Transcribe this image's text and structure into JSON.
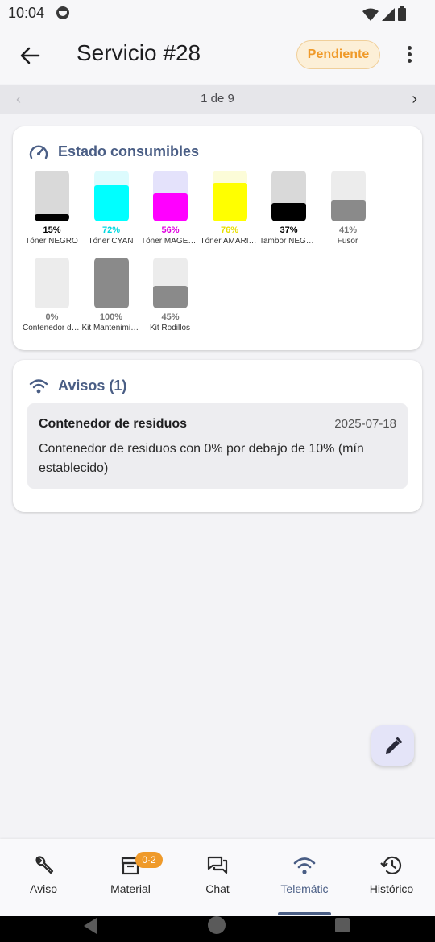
{
  "status_bar": {
    "time": "10:04"
  },
  "app_bar": {
    "title": "Servicio #28",
    "status_badge": "Pendiente"
  },
  "pager": {
    "count": "1 de 9"
  },
  "consumibles": {
    "title": "Estado consumibles",
    "items": [
      {
        "name": "Tóner NEGRO",
        "percent_label": "15%",
        "level": 15,
        "color": "#000000",
        "track": "#d9d9d9",
        "pct_color": "#000000"
      },
      {
        "name": "Tóner CYAN",
        "percent_label": "72%",
        "level": 72,
        "color": "#00ffff",
        "track": "#dcfbfd",
        "pct_color": "#00d8e0"
      },
      {
        "name": "Tóner MAGENTA",
        "percent_label": "56%",
        "level": 56,
        "color": "#ff00ff",
        "track": "#e4e2fb",
        "pct_color": "#e000e0"
      },
      {
        "name": "Tóner AMARILLO",
        "percent_label": "76%",
        "level": 76,
        "color": "#ffff00",
        "track": "#fcfcd8",
        "pct_color": "#e8e000"
      },
      {
        "name": "Tambor NEGRO",
        "percent_label": "37%",
        "level": 37,
        "color": "#000000",
        "track": "#d9d9d9",
        "pct_color": "#000000"
      },
      {
        "name": "Fusor",
        "percent_label": "41%",
        "level": 41,
        "color": "#8a8a8a",
        "track": "#ececec",
        "pct_color": "#777777"
      },
      {
        "name": "Contenedor de residuos",
        "percent_label": "0%",
        "level": 0,
        "color": "#8a8a8a",
        "track": "#ececec",
        "pct_color": "#777777"
      },
      {
        "name": "Kit Mantenimiento",
        "percent_label": "100%",
        "level": 100,
        "color": "#8a8a8a",
        "track": "#ececec",
        "pct_color": "#777777"
      },
      {
        "name": "Kit Rodillos",
        "percent_label": "45%",
        "level": 45,
        "color": "#8a8a8a",
        "track": "#ececec",
        "pct_color": "#777777"
      }
    ]
  },
  "avisos": {
    "title": "Avisos (1)",
    "alert": {
      "title": "Contenedor de residuos",
      "date": "2025-07-18",
      "message": "Contenedor de residuos con 0% por debajo de 10% (mín establecido)"
    }
  },
  "bottom_nav": {
    "tabs": [
      {
        "label": "Aviso",
        "icon": "wrench-icon"
      },
      {
        "label": "Material",
        "icon": "archive-icon",
        "badge": "0·2"
      },
      {
        "label": "Chat",
        "icon": "chat-icon"
      },
      {
        "label": "Telemátic",
        "icon": "wifi-icon",
        "active": true
      },
      {
        "label": "Histórico",
        "icon": "history-icon"
      }
    ]
  },
  "colors": {
    "accent": "#4a5e85",
    "badge_text": "#ef9a2a",
    "badge_bg": "#fcefd7"
  }
}
